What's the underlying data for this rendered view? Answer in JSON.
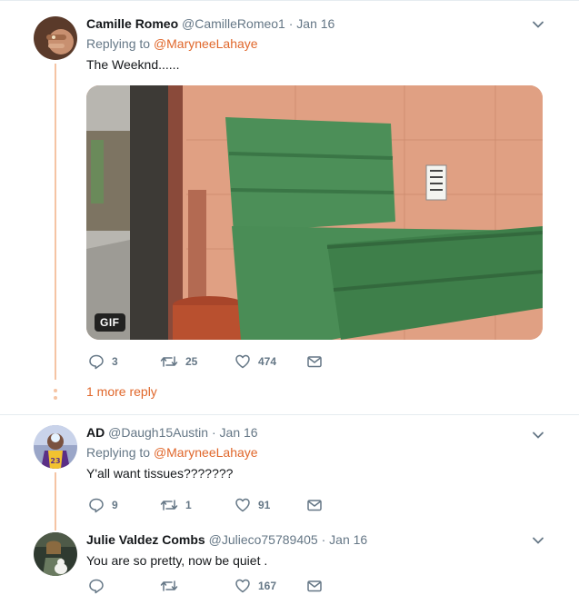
{
  "tweets": [
    {
      "name": "Camille Romeo",
      "handle": "@CamilleRomeo1",
      "sep": " · ",
      "time": "Jan 16",
      "replying_prefix": "Replying to ",
      "replying_to": "@MaryneeLahaye",
      "text": "The Weeknd......",
      "media_badge": "GIF",
      "replies": "3",
      "retweets": "25",
      "likes": "474",
      "more_reply": "1 more reply"
    },
    {
      "name": "AD",
      "handle": "@Daugh15Austin",
      "sep": " · ",
      "time": "Jan 16",
      "replying_prefix": "Replying to ",
      "replying_to": "@MaryneeLahaye",
      "text": "Y'all want tissues???????",
      "replies": "9",
      "retweets": "1",
      "likes": "91"
    },
    {
      "name": "Julie Valdez Combs",
      "handle": "@Julieco75789405",
      "sep": " · ",
      "time": "Jan 16",
      "text": "You are so pretty, now be quiet .",
      "replies": "",
      "retweets": "",
      "likes": "167"
    }
  ],
  "icons": {
    "reply": "reply-icon",
    "retweet": "retweet-icon",
    "like": "heart-icon",
    "dm": "envelope-icon",
    "more": "chevron-down-icon"
  },
  "colors": {
    "accent": "#e0672b",
    "thread_line": "#f5c4a4",
    "muted": "#657786"
  }
}
